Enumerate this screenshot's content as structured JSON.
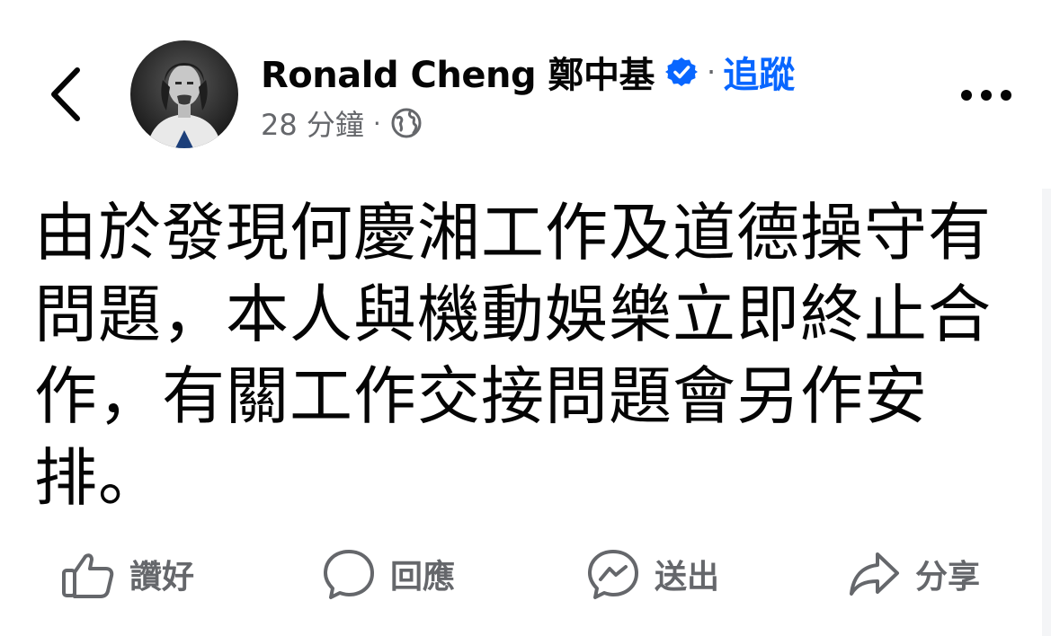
{
  "header": {
    "author_name": "Ronald Cheng 鄭中基",
    "separator": "·",
    "follow_label": "追蹤",
    "timestamp": "28 分鐘",
    "meta_separator": "·",
    "icons": {
      "back": "chevron-left-icon",
      "verified": "verified-badge-icon",
      "audience": "globe-icon",
      "more": "more-horizontal-icon"
    }
  },
  "post": {
    "text": "由於發現何慶湘工作及道德操守有\n問題，本人與機動娛樂立即終止合\n作，有關工作交接問題會另作安\n排。"
  },
  "actions": [
    {
      "label": "讚好",
      "icon": "thumbs-up-icon"
    },
    {
      "label": "回應",
      "icon": "comment-bubble-icon"
    },
    {
      "label": "送出",
      "icon": "messenger-icon"
    },
    {
      "label": "分享",
      "icon": "share-arrow-icon"
    }
  ],
  "colors": {
    "text": "#050505",
    "secondary": "#65676b",
    "accent": "#0866ff"
  }
}
